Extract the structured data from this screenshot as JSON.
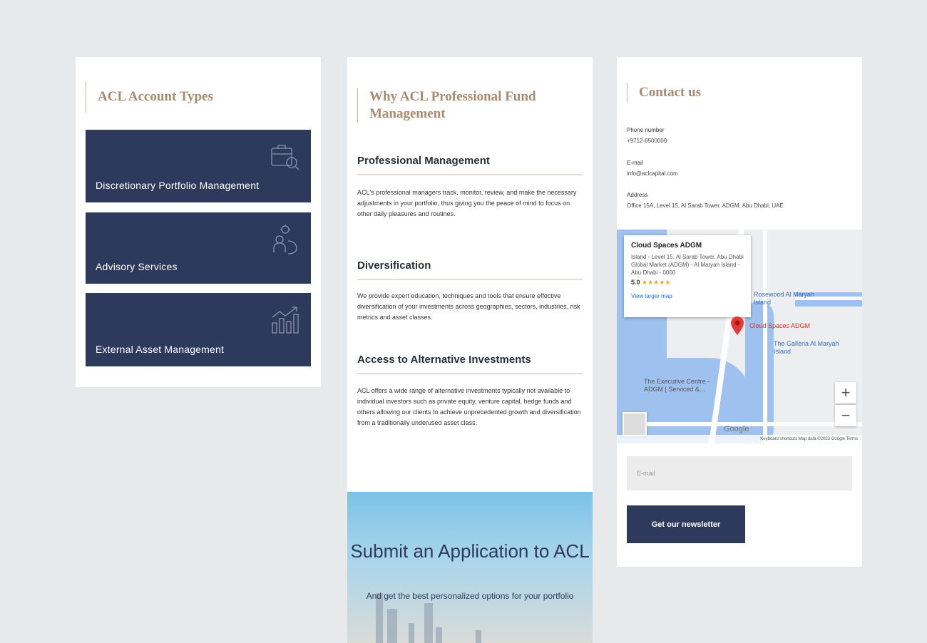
{
  "account_types": {
    "title": "ACL Account Types",
    "cards": [
      {
        "label": "Discretionary Portfolio Management",
        "icon": "briefcase-search-icon"
      },
      {
        "label": "Advisory Services",
        "icon": "person-idea-icon"
      },
      {
        "label": "External Asset Management",
        "icon": "growth-chart-icon"
      }
    ]
  },
  "why": {
    "title": "Why ACL Professional Fund Management",
    "sections": [
      {
        "heading": "Professional Management",
        "body": "ACL's professional managers track, monitor, review, and make the necessary adjustments in your portfolio, thus giving you the peace of mind to focus on other daily pleasures and routines."
      },
      {
        "heading": "Diversification",
        "body": "We provide expert education, techniques and tools that ensure effective diversification of your investments across geographies, sectors, industries, risk metrics and asset classes."
      },
      {
        "heading": "Access to Alternative Investments",
        "body": "ACL offers a wide range of alternative investments typically not available to individual investors such as private equity, venture capital, hedge funds and others allowing our clients to achieve unprecedented growth and diversification from a traditionally underused asset class."
      }
    ],
    "apply": {
      "title": "Submit an Application to ACL",
      "subtitle": "And get the best personalized options for your portfolio"
    }
  },
  "contact": {
    "title": "Contact us",
    "phone_label": "Phone number",
    "phone_value": "+9712-6500000",
    "email_label": "E-mail",
    "email_value": "info@aclcapital.com",
    "address_label": "Address",
    "address_value": "Office 15A, Level 15, Al Sarab Tower, ADGM, Abu Dhabi, UAE",
    "map": {
      "place_name": "Cloud Spaces ADGM",
      "place_address": "Island - Level 15, Al Sarab Tower, Abu Dhabi Global Market (ADGM) - Al Maryah Island - Abu Dhabi - 0000",
      "rating": "5.0",
      "stars": "★★★★★",
      "larger_map": "View larger map",
      "pin_label": "Cloud Spaces ADGM",
      "poi_1": "Rosewood Al Maryah Island",
      "poi_2": "The Galleria Al Maryah Island",
      "poi_3": "The Executive Centre - ADGM | Serviced &...",
      "google": "Google",
      "zoom_in": "+",
      "zoom_out": "−",
      "attribution": "Keyboard shortcuts   Map data ©2023 Google   Terms"
    },
    "email_placeholder": "E-mail",
    "newsletter_button": "Get our newsletter"
  },
  "colors": {
    "navy": "#2d3a5c",
    "gold": "#a88a6e",
    "background": "#e8e9eb"
  }
}
